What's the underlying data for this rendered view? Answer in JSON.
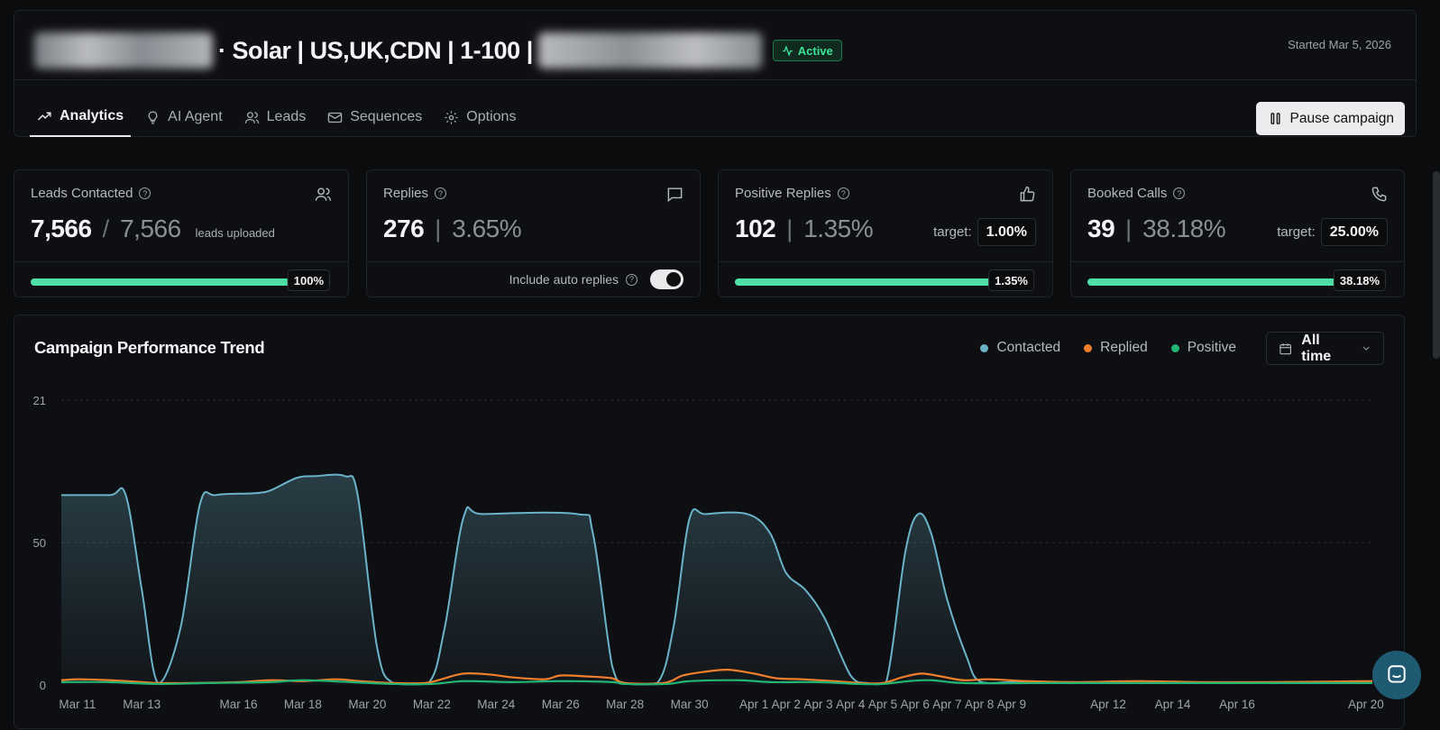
{
  "header": {
    "campaign_title": "· Solar | US,UK,CDN | 1-100 |",
    "status": "Active",
    "started": "Started Mar 5, 2026",
    "pause_label": "Pause campaign"
  },
  "tabs": [
    {
      "label": "Analytics",
      "icon": "trend-icon",
      "active": true
    },
    {
      "label": "AI Agent",
      "icon": "lightbulb-icon",
      "active": false
    },
    {
      "label": "Leads",
      "icon": "users-icon",
      "active": false
    },
    {
      "label": "Sequences",
      "icon": "mail-icon",
      "active": false
    },
    {
      "label": "Options",
      "icon": "gear-icon",
      "active": false
    }
  ],
  "stats": {
    "leads": {
      "label": "Leads Contacted",
      "value": "7,566",
      "total": "7,566",
      "note": "leads uploaded",
      "progress_label": "100%",
      "progress": 1.0
    },
    "replies": {
      "label": "Replies",
      "value": "276",
      "rate": "3.65%",
      "auto_label": "Include auto replies",
      "auto_on": true
    },
    "positive": {
      "label": "Positive Replies",
      "value": "102",
      "rate": "1.35%",
      "target_label": "target:",
      "target": "1.00%",
      "progress_label": "1.35%",
      "progress": 1.0
    },
    "booked": {
      "label": "Booked Calls",
      "value": "39",
      "rate": "38.18%",
      "target_label": "target:",
      "target": "25.00%",
      "progress_label": "38.18%",
      "progress": 1.0
    }
  },
  "chart": {
    "title": "Campaign Performance Trend",
    "range": "All time",
    "legend": [
      {
        "name": "Contacted",
        "color": "#6bb3c9"
      },
      {
        "name": "Replied",
        "color": "#f07f2c"
      },
      {
        "name": "Positive",
        "color": "#22b573"
      }
    ]
  },
  "chart_data": {
    "type": "area",
    "y_ticks": [
      "0",
      "50",
      "21"
    ],
    "y_tick_values": [
      0,
      150,
      300
    ],
    "ylim": [
      0,
      300
    ],
    "x_ticks": [
      "Mar 11",
      "Mar 13",
      "Mar 16",
      "Mar 18",
      "Mar 20",
      "Mar 22",
      "Mar 24",
      "Mar 26",
      "Mar 28",
      "Mar 30",
      "Apr 1",
      "Apr 2",
      "Apr 3",
      "Apr 4",
      "Apr 5",
      "Apr 6",
      "Apr 7",
      "Apr 8",
      "Apr 9",
      "Apr 12",
      "Apr 14",
      "Apr 16",
      "Apr 20"
    ],
    "x_tick_days": [
      10,
      12,
      15,
      17,
      19,
      21,
      23,
      25,
      27,
      29,
      31,
      32,
      33,
      34,
      35,
      36,
      37,
      38,
      39,
      42,
      44,
      46,
      50
    ],
    "x_range_days": [
      9.5,
      50.2
    ],
    "series": [
      {
        "name": "Contacted",
        "color": "#6bb3c9",
        "points": [
          [
            9.5,
            200
          ],
          [
            11,
            200
          ],
          [
            11.5,
            200
          ],
          [
            12,
            100
          ],
          [
            12.5,
            2
          ],
          [
            13.2,
            60
          ],
          [
            13.8,
            190
          ],
          [
            14.3,
            200
          ],
          [
            15.5,
            202
          ],
          [
            16,
            205
          ],
          [
            16.8,
            218
          ],
          [
            17.4,
            220
          ],
          [
            18.3,
            220
          ],
          [
            18.7,
            200
          ],
          [
            19.3,
            40
          ],
          [
            19.8,
            2
          ],
          [
            20.9,
            2
          ],
          [
            21.4,
            60
          ],
          [
            22,
            178
          ],
          [
            22.6,
            180
          ],
          [
            25.5,
            180
          ],
          [
            26,
            160
          ],
          [
            26.6,
            20
          ],
          [
            27,
            2
          ],
          [
            28,
            2
          ],
          [
            28.5,
            60
          ],
          [
            29,
            175
          ],
          [
            29.5,
            180
          ],
          [
            30.8,
            180
          ],
          [
            31.5,
            160
          ],
          [
            32,
            118
          ],
          [
            32.6,
            100
          ],
          [
            33.2,
            70
          ],
          [
            34,
            10
          ],
          [
            34.5,
            2
          ],
          [
            35.1,
            2
          ],
          [
            35.7,
            140
          ],
          [
            36.1,
            180
          ],
          [
            36.5,
            160
          ],
          [
            37,
            90
          ],
          [
            37.6,
            30
          ],
          [
            38,
            4
          ],
          [
            39,
            3
          ],
          [
            40,
            2
          ],
          [
            42,
            2
          ],
          [
            44,
            2
          ],
          [
            46,
            2
          ],
          [
            48,
            2
          ],
          [
            50.2,
            2
          ]
        ]
      },
      {
        "name": "Replied",
        "color": "#f07f2c",
        "points": [
          [
            9.5,
            5
          ],
          [
            10,
            6
          ],
          [
            11,
            5
          ],
          [
            12,
            3
          ],
          [
            12.5,
            2
          ],
          [
            13.5,
            2
          ],
          [
            15,
            3
          ],
          [
            16,
            5
          ],
          [
            17,
            4
          ],
          [
            18,
            6
          ],
          [
            18.8,
            4
          ],
          [
            19.8,
            2
          ],
          [
            20.8,
            2
          ],
          [
            21.3,
            6
          ],
          [
            22,
            12
          ],
          [
            22.8,
            11
          ],
          [
            23.5,
            8
          ],
          [
            24.5,
            6
          ],
          [
            25,
            10
          ],
          [
            25.8,
            9
          ],
          [
            26.6,
            7
          ],
          [
            27,
            2
          ],
          [
            28.2,
            2
          ],
          [
            28.8,
            10
          ],
          [
            29.5,
            14
          ],
          [
            30.2,
            16
          ],
          [
            31,
            12
          ],
          [
            31.7,
            7
          ],
          [
            32.5,
            6
          ],
          [
            33.5,
            4
          ],
          [
            34.3,
            2
          ],
          [
            35,
            2
          ],
          [
            35.6,
            8
          ],
          [
            36.2,
            12
          ],
          [
            36.8,
            9
          ],
          [
            37.5,
            5
          ],
          [
            38.3,
            6
          ],
          [
            39.5,
            4
          ],
          [
            41,
            3
          ],
          [
            43,
            4
          ],
          [
            45,
            3
          ],
          [
            47,
            3
          ],
          [
            50.2,
            4
          ]
        ]
      },
      {
        "name": "Positive",
        "color": "#22b573",
        "points": [
          [
            9.5,
            3
          ],
          [
            11,
            3
          ],
          [
            12.5,
            1
          ],
          [
            14,
            2
          ],
          [
            16,
            3
          ],
          [
            17,
            5
          ],
          [
            18.5,
            3
          ],
          [
            19.8,
            1
          ],
          [
            21,
            1
          ],
          [
            22,
            4
          ],
          [
            23.5,
            3
          ],
          [
            25,
            4
          ],
          [
            26.6,
            3
          ],
          [
            27,
            1
          ],
          [
            28.3,
            1
          ],
          [
            29,
            4
          ],
          [
            30.5,
            5
          ],
          [
            31.5,
            3
          ],
          [
            33,
            3
          ],
          [
            34.3,
            1
          ],
          [
            35,
            1
          ],
          [
            35.8,
            4
          ],
          [
            36.5,
            5
          ],
          [
            37.5,
            2
          ],
          [
            40,
            2
          ],
          [
            43,
            2
          ],
          [
            46,
            2
          ],
          [
            50.2,
            2
          ]
        ]
      }
    ]
  },
  "chat": {
    "icon": "chat-icon"
  }
}
